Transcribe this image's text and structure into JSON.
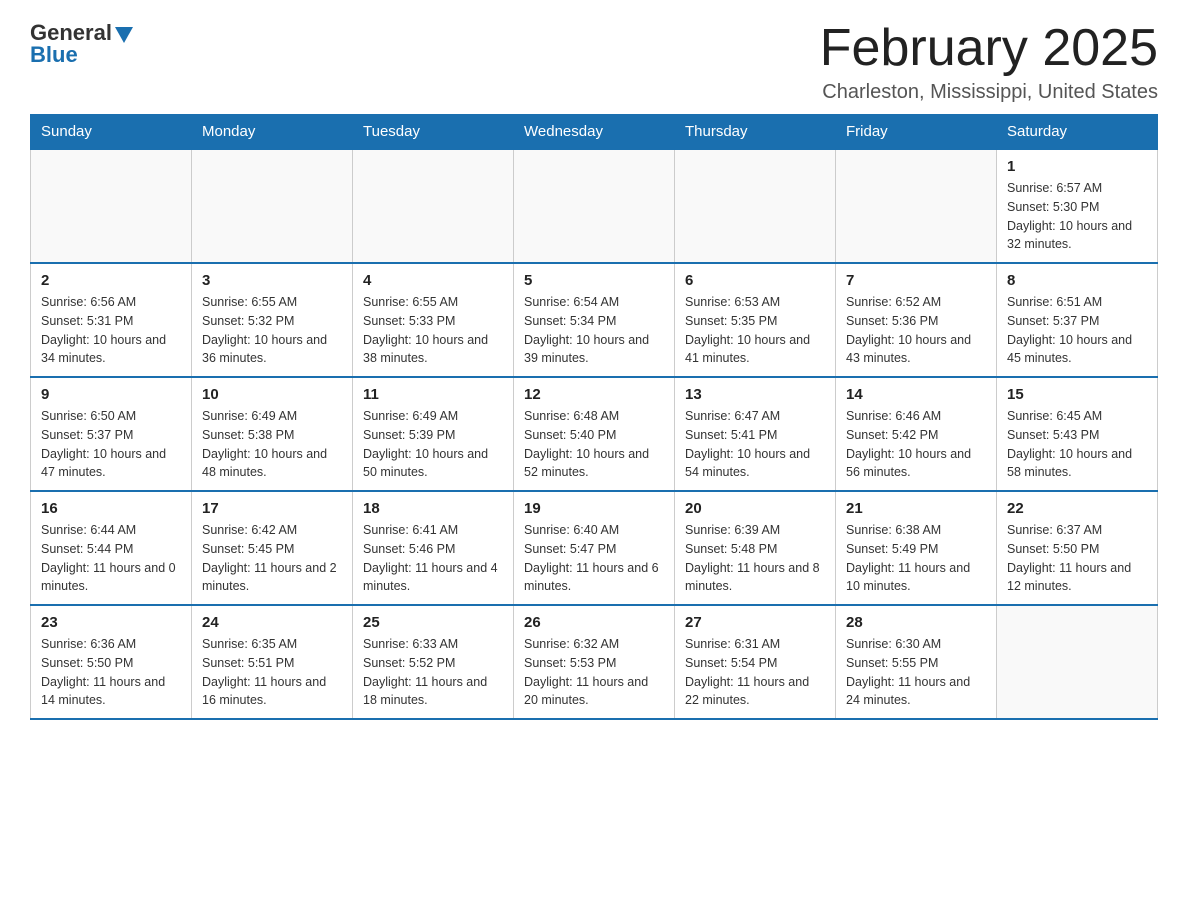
{
  "logo": {
    "general": "General",
    "blue": "Blue"
  },
  "header": {
    "month": "February 2025",
    "location": "Charleston, Mississippi, United States"
  },
  "weekdays": [
    "Sunday",
    "Monday",
    "Tuesday",
    "Wednesday",
    "Thursday",
    "Friday",
    "Saturday"
  ],
  "weeks": [
    [
      {
        "day": "",
        "sunrise": "",
        "sunset": "",
        "daylight": ""
      },
      {
        "day": "",
        "sunrise": "",
        "sunset": "",
        "daylight": ""
      },
      {
        "day": "",
        "sunrise": "",
        "sunset": "",
        "daylight": ""
      },
      {
        "day": "",
        "sunrise": "",
        "sunset": "",
        "daylight": ""
      },
      {
        "day": "",
        "sunrise": "",
        "sunset": "",
        "daylight": ""
      },
      {
        "day": "",
        "sunrise": "",
        "sunset": "",
        "daylight": ""
      },
      {
        "day": "1",
        "sunrise": "Sunrise: 6:57 AM",
        "sunset": "Sunset: 5:30 PM",
        "daylight": "Daylight: 10 hours and 32 minutes."
      }
    ],
    [
      {
        "day": "2",
        "sunrise": "Sunrise: 6:56 AM",
        "sunset": "Sunset: 5:31 PM",
        "daylight": "Daylight: 10 hours and 34 minutes."
      },
      {
        "day": "3",
        "sunrise": "Sunrise: 6:55 AM",
        "sunset": "Sunset: 5:32 PM",
        "daylight": "Daylight: 10 hours and 36 minutes."
      },
      {
        "day": "4",
        "sunrise": "Sunrise: 6:55 AM",
        "sunset": "Sunset: 5:33 PM",
        "daylight": "Daylight: 10 hours and 38 minutes."
      },
      {
        "day": "5",
        "sunrise": "Sunrise: 6:54 AM",
        "sunset": "Sunset: 5:34 PM",
        "daylight": "Daylight: 10 hours and 39 minutes."
      },
      {
        "day": "6",
        "sunrise": "Sunrise: 6:53 AM",
        "sunset": "Sunset: 5:35 PM",
        "daylight": "Daylight: 10 hours and 41 minutes."
      },
      {
        "day": "7",
        "sunrise": "Sunrise: 6:52 AM",
        "sunset": "Sunset: 5:36 PM",
        "daylight": "Daylight: 10 hours and 43 minutes."
      },
      {
        "day": "8",
        "sunrise": "Sunrise: 6:51 AM",
        "sunset": "Sunset: 5:37 PM",
        "daylight": "Daylight: 10 hours and 45 minutes."
      }
    ],
    [
      {
        "day": "9",
        "sunrise": "Sunrise: 6:50 AM",
        "sunset": "Sunset: 5:37 PM",
        "daylight": "Daylight: 10 hours and 47 minutes."
      },
      {
        "day": "10",
        "sunrise": "Sunrise: 6:49 AM",
        "sunset": "Sunset: 5:38 PM",
        "daylight": "Daylight: 10 hours and 48 minutes."
      },
      {
        "day": "11",
        "sunrise": "Sunrise: 6:49 AM",
        "sunset": "Sunset: 5:39 PM",
        "daylight": "Daylight: 10 hours and 50 minutes."
      },
      {
        "day": "12",
        "sunrise": "Sunrise: 6:48 AM",
        "sunset": "Sunset: 5:40 PM",
        "daylight": "Daylight: 10 hours and 52 minutes."
      },
      {
        "day": "13",
        "sunrise": "Sunrise: 6:47 AM",
        "sunset": "Sunset: 5:41 PM",
        "daylight": "Daylight: 10 hours and 54 minutes."
      },
      {
        "day": "14",
        "sunrise": "Sunrise: 6:46 AM",
        "sunset": "Sunset: 5:42 PM",
        "daylight": "Daylight: 10 hours and 56 minutes."
      },
      {
        "day": "15",
        "sunrise": "Sunrise: 6:45 AM",
        "sunset": "Sunset: 5:43 PM",
        "daylight": "Daylight: 10 hours and 58 minutes."
      }
    ],
    [
      {
        "day": "16",
        "sunrise": "Sunrise: 6:44 AM",
        "sunset": "Sunset: 5:44 PM",
        "daylight": "Daylight: 11 hours and 0 minutes."
      },
      {
        "day": "17",
        "sunrise": "Sunrise: 6:42 AM",
        "sunset": "Sunset: 5:45 PM",
        "daylight": "Daylight: 11 hours and 2 minutes."
      },
      {
        "day": "18",
        "sunrise": "Sunrise: 6:41 AM",
        "sunset": "Sunset: 5:46 PM",
        "daylight": "Daylight: 11 hours and 4 minutes."
      },
      {
        "day": "19",
        "sunrise": "Sunrise: 6:40 AM",
        "sunset": "Sunset: 5:47 PM",
        "daylight": "Daylight: 11 hours and 6 minutes."
      },
      {
        "day": "20",
        "sunrise": "Sunrise: 6:39 AM",
        "sunset": "Sunset: 5:48 PM",
        "daylight": "Daylight: 11 hours and 8 minutes."
      },
      {
        "day": "21",
        "sunrise": "Sunrise: 6:38 AM",
        "sunset": "Sunset: 5:49 PM",
        "daylight": "Daylight: 11 hours and 10 minutes."
      },
      {
        "day": "22",
        "sunrise": "Sunrise: 6:37 AM",
        "sunset": "Sunset: 5:50 PM",
        "daylight": "Daylight: 11 hours and 12 minutes."
      }
    ],
    [
      {
        "day": "23",
        "sunrise": "Sunrise: 6:36 AM",
        "sunset": "Sunset: 5:50 PM",
        "daylight": "Daylight: 11 hours and 14 minutes."
      },
      {
        "day": "24",
        "sunrise": "Sunrise: 6:35 AM",
        "sunset": "Sunset: 5:51 PM",
        "daylight": "Daylight: 11 hours and 16 minutes."
      },
      {
        "day": "25",
        "sunrise": "Sunrise: 6:33 AM",
        "sunset": "Sunset: 5:52 PM",
        "daylight": "Daylight: 11 hours and 18 minutes."
      },
      {
        "day": "26",
        "sunrise": "Sunrise: 6:32 AM",
        "sunset": "Sunset: 5:53 PM",
        "daylight": "Daylight: 11 hours and 20 minutes."
      },
      {
        "day": "27",
        "sunrise": "Sunrise: 6:31 AM",
        "sunset": "Sunset: 5:54 PM",
        "daylight": "Daylight: 11 hours and 22 minutes."
      },
      {
        "day": "28",
        "sunrise": "Sunrise: 6:30 AM",
        "sunset": "Sunset: 5:55 PM",
        "daylight": "Daylight: 11 hours and 24 minutes."
      },
      {
        "day": "",
        "sunrise": "",
        "sunset": "",
        "daylight": ""
      }
    ]
  ]
}
